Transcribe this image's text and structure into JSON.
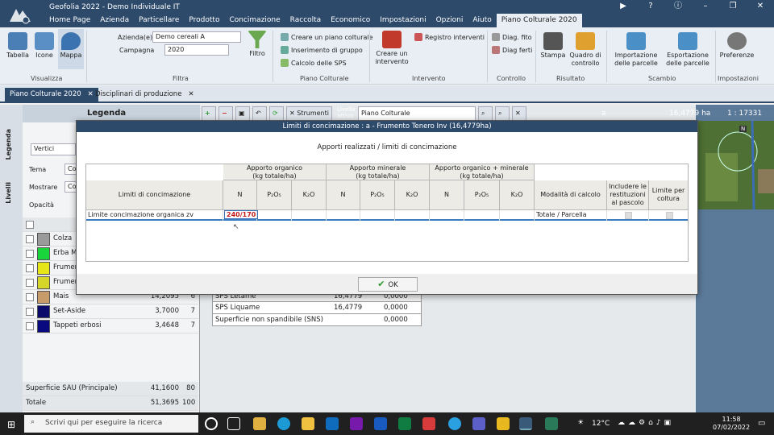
{
  "window": {
    "title": "Geofolia 2022 - Demo Individuale IT",
    "menu": [
      "Home Page",
      "Azienda",
      "Particellare",
      "Prodotto",
      "Concimazione",
      "Raccolta",
      "Economico",
      "Impostazioni",
      "Opzioni",
      "Aiuto",
      "Piano Colturale 2020"
    ]
  },
  "ribbon": {
    "visualizza": {
      "tabella": "Tabella",
      "icone": "Icone",
      "mappa": "Mappa",
      "group": "Visualizza"
    },
    "filtra": {
      "azienda_label": "Azienda(e)",
      "azienda_value": "Demo cereali A",
      "campagna_label": "Campagna",
      "campagna_value": "2020",
      "filtro": "Filtro",
      "group": "Filtra"
    },
    "piano": {
      "crea": "Creare un piano colturale",
      "inserimento": "Inserimento di gruppo",
      "calcolo": "Calcolo delle SPS",
      "group": "Piano Colturale"
    },
    "intervento": {
      "crea": "Creare un intervento",
      "registro": "Registro interventi",
      "group": "Intervento"
    },
    "controllo": {
      "diag_fito": "Diag. fito",
      "diag_ferti": "Diag ferti",
      "group": "Controllo"
    },
    "risultato": {
      "stampa": "Stampa",
      "quadro": "Quadro di controllo",
      "group": "Risultato"
    },
    "scambio": {
      "importazione": "Importazione delle parcelle",
      "esportazione": "Esportazione delle parcelle",
      "group": "Scambio"
    },
    "impostazioni": {
      "preferenze": "Preferenze",
      "group": "Impostazioni"
    }
  },
  "doc_tabs": [
    "Piano Colturale 2020",
    "Disciplinari di produzione"
  ],
  "legend": {
    "title": "Legenda",
    "vertici": "Vertici",
    "tema_label": "Tema",
    "tema_value": "Co",
    "mostrare_label": "Mostrare",
    "mostrare_value": "Co",
    "opacita_label": "Opacità",
    "side_tab_legenda": "Legenda",
    "side_tab_livelli": "Livelli",
    "items": [
      {
        "name": "Colza",
        "area": "",
        "count": "",
        "color": "#9a9a9a"
      },
      {
        "name": "Erba M",
        "area": "",
        "count": "",
        "color": "#19d43a"
      },
      {
        "name": "Frumen",
        "area": "",
        "count": "",
        "color": "#e5e518"
      },
      {
        "name": "Frumen",
        "area": "",
        "count": "",
        "color": "#d6d62a"
      },
      {
        "name": "Mais",
        "area": "14,2095",
        "count": "6",
        "color": "#c89b6a"
      },
      {
        "name": "Set-Aside",
        "area": "3,7000",
        "count": "7",
        "color": "#0a0a6a"
      },
      {
        "name": "Tappeti erbosi",
        "area": "3,4648",
        "count": "7",
        "color": "#0a0a80"
      }
    ],
    "superficie_label": "Superficie SAU (Principale)",
    "superficie_value": "41,1600",
    "superficie_count": "80",
    "totale_label": "Totale",
    "totale_value": "51,3695",
    "totale_count": "100"
  },
  "toolbar2": {
    "strumenti": "Strumenti",
    "livello": "Livello attivo",
    "livello_value": "Piano Colturale"
  },
  "map_info": {
    "a": "a",
    "area": "16,4779 ha",
    "scale": "1 : 17331"
  },
  "sps_table": [
    {
      "label": "SPS Letame",
      "v1": "16,4779",
      "v2": "0,0000"
    },
    {
      "label": "SPS Liquame",
      "v1": "16,4779",
      "v2": "0,0000"
    },
    {
      "label": "Superficie non spandibile (SNS)",
      "v1": "",
      "v2": "0,0000"
    }
  ],
  "dialog": {
    "title": "Limiti di concimazione : a - Frumento Tenero Inv (16,4779ha)",
    "subtitle": "Apporti realizzati / limiti di concimazione",
    "col_limiti": "Limiti di concimazione",
    "grp_organico": "Apporto organico\n(kg totale/ha)",
    "grp_minerale": "Apporto minerale\n(kg totale/ha)",
    "grp_orgmin": "Apporto organico + minerale\n(kg totale/ha)",
    "col_n": "N",
    "col_p": "P₂O₅",
    "col_k": "K₂O",
    "col_modalita": "Modalità di calcolo",
    "col_includere": "Includere le restituzioni al pascolo",
    "col_limite": "Limite per coltura",
    "row_label": "Limite concimazione organica zv",
    "row_value": "240/170",
    "row_modalita": "Totale / Parcella",
    "ok": "OK"
  },
  "taskbar": {
    "search": "Scrivi qui per eseguire la ricerca",
    "temp": "12°C",
    "time": "11:58",
    "date": "07/02/2022"
  }
}
